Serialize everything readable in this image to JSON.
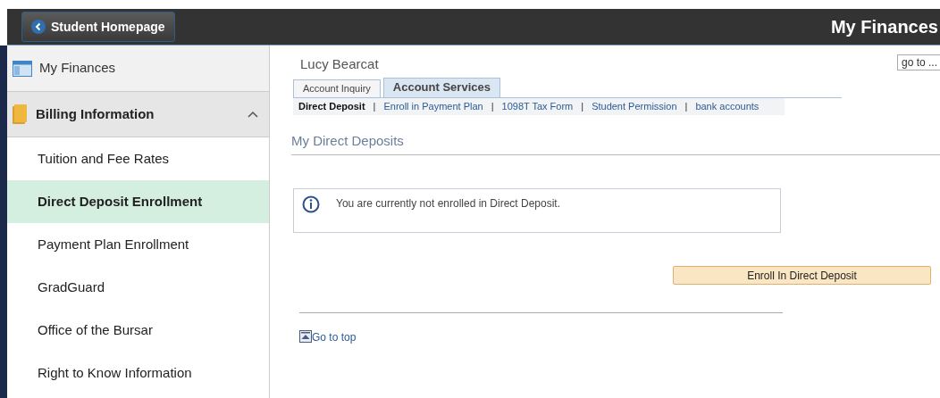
{
  "header": {
    "back_button": "Student Homepage",
    "title": "My Finances"
  },
  "sidebar": {
    "items": [
      {
        "label": "My Finances",
        "kind": "top",
        "selected": false
      },
      {
        "label": "Billing Information",
        "kind": "group",
        "expanded": true,
        "selected": false,
        "children": [
          {
            "label": "Tuition and Fee Rates",
            "selected": false
          },
          {
            "label": "Direct Deposit Enrollment",
            "selected": true
          },
          {
            "label": "Payment Plan Enrollment",
            "selected": false
          },
          {
            "label": "GradGuard",
            "selected": false
          },
          {
            "label": "Office of the Bursar",
            "selected": false
          },
          {
            "label": "Right to Know Information",
            "selected": false
          }
        ]
      }
    ]
  },
  "content": {
    "student_name": "Lucy Bearcat",
    "goto": "go to ...",
    "tabs": [
      {
        "label": "Account Inquiry",
        "selected": false
      },
      {
        "label": "Account Services",
        "selected": true
      }
    ],
    "subtabs": [
      {
        "label": "Direct Deposit",
        "selected": true
      },
      {
        "label": "Enroll in Payment Plan",
        "selected": false
      },
      {
        "label": "1098T Tax Form",
        "selected": false
      },
      {
        "label": "Student Permission",
        "selected": false
      },
      {
        "label": "bank accounts",
        "selected": false
      }
    ],
    "subtab_separators": [
      "|",
      "|",
      "|",
      "|"
    ],
    "section_title": "My Direct Deposits",
    "message": "You are currently not enrolled in Direct Deposit.",
    "enroll_button": "Enroll In Direct Deposit",
    "go_to_top": "Go to top"
  }
}
